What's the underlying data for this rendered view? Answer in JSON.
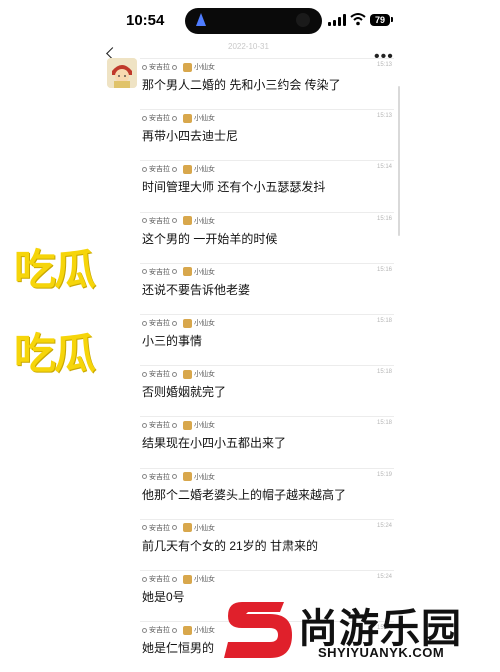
{
  "status_bar": {
    "time": "10:54",
    "battery": "79",
    "signal_icon": "signal-icon",
    "wifi_icon": "wifi-icon",
    "nav_icon": "location-arrow-icon"
  },
  "chat": {
    "date": "2022-10-31",
    "more": "•••",
    "messages": [
      {
        "sender": "安吉拉",
        "recipient": "小仙女",
        "time": "15:13",
        "text": "那个男人二婚的 先和小三约会 传染了"
      },
      {
        "sender": "安吉拉",
        "recipient": "小仙女",
        "time": "15:13",
        "text": "再带小四去迪士尼"
      },
      {
        "sender": "安吉拉",
        "recipient": "小仙女",
        "time": "15:14",
        "text": "时间管理大师 还有个小五瑟瑟发抖"
      },
      {
        "sender": "安吉拉",
        "recipient": "小仙女",
        "time": "15:16",
        "text": "这个男的 一开始羊的时候"
      },
      {
        "sender": "安吉拉",
        "recipient": "小仙女",
        "time": "15:16",
        "text": "还说不要告诉他老婆"
      },
      {
        "sender": "安吉拉",
        "recipient": "小仙女",
        "time": "15:18",
        "text": "小三的事情"
      },
      {
        "sender": "安吉拉",
        "recipient": "小仙女",
        "time": "15:18",
        "text": "否则婚姻就完了"
      },
      {
        "sender": "安吉拉",
        "recipient": "小仙女",
        "time": "15:18",
        "text": "结果现在小四小五都出来了"
      },
      {
        "sender": "安吉拉",
        "recipient": "小仙女",
        "time": "15:19",
        "text": "他那个二婚老婆头上的帽子越来越高了"
      },
      {
        "sender": "安吉拉",
        "recipient": "小仙女",
        "time": "15:24",
        "text": "前几天有个女的 21岁的 甘肃来的"
      },
      {
        "sender": "安吉拉",
        "recipient": "小仙女",
        "time": "15:24",
        "text": "她是0号"
      },
      {
        "sender": "安吉拉",
        "recipient": "小仙女",
        "time": "15:24",
        "text": "她是仁恒男的"
      }
    ]
  },
  "overlay": {
    "line1": "吃瓜",
    "line2": "吃瓜"
  },
  "watermark": {
    "name": "尚游乐园",
    "url": "SHYIYUANYK.COM"
  }
}
